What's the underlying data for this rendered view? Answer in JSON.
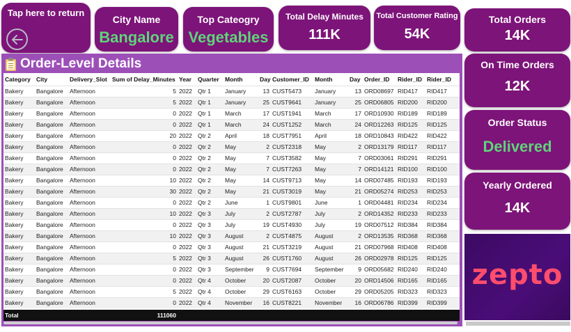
{
  "nav": {
    "back_label": "Tap here to return"
  },
  "kpis": {
    "city_label": "City Name",
    "city_value": "Bangalore",
    "category_label": "Top Cateogry",
    "category_value": "Vegetables",
    "delay_label": "Total Delay Minutes",
    "delay_value": "111K",
    "rating_label": "Total Customer Rating",
    "rating_value": "54K",
    "orders_label": "Total Orders",
    "orders_value": "14K",
    "ontime_label": "On Time Orders",
    "ontime_value": "12K",
    "status_label": "Order Status",
    "status_value": "Delivered",
    "yearly_label": "Yearly Ordered",
    "yearly_value": "14K"
  },
  "brand": {
    "logo_text": "zepto",
    "logo_color": "#ff4d6d",
    "accent": "#7d1479",
    "highlight": "#5fd47a"
  },
  "table": {
    "title": "Order-Level Details",
    "columns": [
      "Category",
      "City",
      "Delivery_Slot",
      "Sum of Delay_Minutes",
      "Year",
      "Quarter",
      "Month",
      "Day",
      "Customer_ID",
      "Month",
      "Day",
      "Order_ID",
      "Rider_ID",
      "Rider_ID"
    ],
    "rows": [
      [
        "Bakery",
        "Bangalore",
        "Afternoon",
        "5",
        "2022",
        "Qtr 1",
        "January",
        "13",
        "CUST5473",
        "January",
        "13",
        "ORD08697",
        "RID417",
        "RID417"
      ],
      [
        "Bakery",
        "Bangalore",
        "Afternoon",
        "5",
        "2022",
        "Qtr 1",
        "January",
        "25",
        "CUST9641",
        "January",
        "25",
        "ORD06805",
        "RID200",
        "RID200"
      ],
      [
        "Bakery",
        "Bangalore",
        "Afternoon",
        "0",
        "2022",
        "Qtr 1",
        "March",
        "17",
        "CUST1941",
        "March",
        "17",
        "ORD10930",
        "RID189",
        "RID189"
      ],
      [
        "Bakery",
        "Bangalore",
        "Afternoon",
        "0",
        "2022",
        "Qtr 1",
        "March",
        "24",
        "CUST1252",
        "March",
        "24",
        "ORD12263",
        "RID125",
        "RID125"
      ],
      [
        "Bakery",
        "Bangalore",
        "Afternoon",
        "20",
        "2022",
        "Qtr 2",
        "April",
        "18",
        "CUST7951",
        "April",
        "18",
        "ORD10843",
        "RID422",
        "RID422"
      ],
      [
        "Bakery",
        "Bangalore",
        "Afternoon",
        "0",
        "2022",
        "Qtr 2",
        "May",
        "2",
        "CUST2318",
        "May",
        "2",
        "ORD13179",
        "RID117",
        "RID117"
      ],
      [
        "Bakery",
        "Bangalore",
        "Afternoon",
        "0",
        "2022",
        "Qtr 2",
        "May",
        "7",
        "CUST3582",
        "May",
        "7",
        "ORD03061",
        "RID291",
        "RID291"
      ],
      [
        "Bakery",
        "Bangalore",
        "Afternoon",
        "0",
        "2022",
        "Qtr 2",
        "May",
        "7",
        "CUST7263",
        "May",
        "7",
        "ORD14121",
        "RID100",
        "RID100"
      ],
      [
        "Bakery",
        "Bangalore",
        "Afternoon",
        "10",
        "2022",
        "Qtr 2",
        "May",
        "14",
        "CUST9713",
        "May",
        "14",
        "ORD07485",
        "RID193",
        "RID193"
      ],
      [
        "Bakery",
        "Bangalore",
        "Afternoon",
        "30",
        "2022",
        "Qtr 2",
        "May",
        "21",
        "CUST3019",
        "May",
        "21",
        "ORD05274",
        "RID253",
        "RID253"
      ],
      [
        "Bakery",
        "Bangalore",
        "Afternoon",
        "0",
        "2022",
        "Qtr 2",
        "June",
        "1",
        "CUST9801",
        "June",
        "1",
        "ORD04481",
        "RID234",
        "RID234"
      ],
      [
        "Bakery",
        "Bangalore",
        "Afternoon",
        "10",
        "2022",
        "Qtr 3",
        "July",
        "2",
        "CUST2787",
        "July",
        "2",
        "ORD14352",
        "RID233",
        "RID233"
      ],
      [
        "Bakery",
        "Bangalore",
        "Afternoon",
        "0",
        "2022",
        "Qtr 3",
        "July",
        "19",
        "CUST4930",
        "July",
        "19",
        "ORD07512",
        "RID384",
        "RID384"
      ],
      [
        "Bakery",
        "Bangalore",
        "Afternoon",
        "10",
        "2022",
        "Qtr 3",
        "August",
        "2",
        "CUST4875",
        "August",
        "2",
        "ORD13535",
        "RID368",
        "RID368"
      ],
      [
        "Bakery",
        "Bangalore",
        "Afternoon",
        "0",
        "2022",
        "Qtr 3",
        "August",
        "21",
        "CUST3219",
        "August",
        "21",
        "ORD07968",
        "RID408",
        "RID408"
      ],
      [
        "Bakery",
        "Bangalore",
        "Afternoon",
        "5",
        "2022",
        "Qtr 3",
        "August",
        "26",
        "CUST1760",
        "August",
        "26",
        "ORD02978",
        "RID125",
        "RID125"
      ],
      [
        "Bakery",
        "Bangalore",
        "Afternoon",
        "0",
        "2022",
        "Qtr 3",
        "September",
        "9",
        "CUST7694",
        "September",
        "9",
        "ORD05682",
        "RID240",
        "RID240"
      ],
      [
        "Bakery",
        "Bangalore",
        "Afternoon",
        "0",
        "2022",
        "Qtr 4",
        "October",
        "20",
        "CUST2087",
        "October",
        "20",
        "ORD14506",
        "RID165",
        "RID165"
      ],
      [
        "Bakery",
        "Bangalore",
        "Afternoon",
        "5",
        "2022",
        "Qtr 4",
        "October",
        "29",
        "CUST6163",
        "October",
        "29",
        "ORD05205",
        "RID323",
        "RID323"
      ],
      [
        "Bakery",
        "Bangalore",
        "Afternoon",
        "0",
        "2022",
        "Qtr 4",
        "November",
        "16",
        "CUST8221",
        "November",
        "16",
        "ORD06786",
        "RID399",
        "RID399"
      ]
    ],
    "total_label": "Total",
    "total_value": "111060"
  }
}
